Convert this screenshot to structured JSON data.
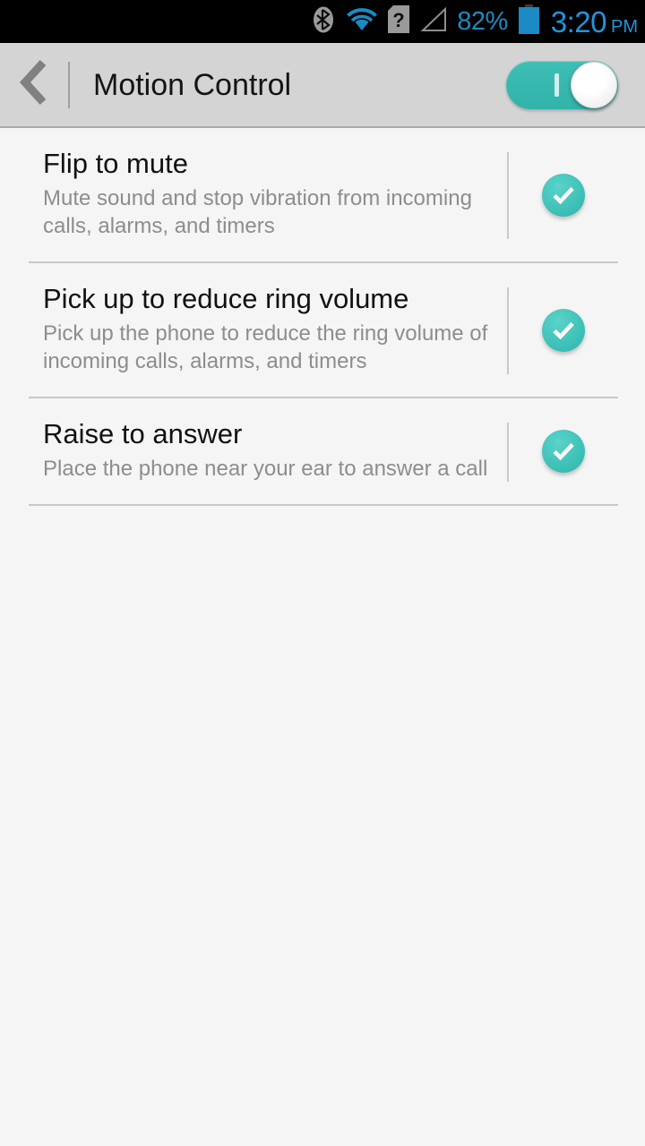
{
  "status_bar": {
    "background": "#000000",
    "accent": "#2196dd",
    "icons": [
      {
        "name": "bluetooth-icon",
        "state": "on",
        "color": "#9a9a9a"
      },
      {
        "name": "wifi-icon",
        "state": "connected",
        "color": "#1a8bc4"
      },
      {
        "name": "sim-card-unknown-icon",
        "state": "unknown",
        "color": "#9a9a9a"
      },
      {
        "name": "cellular-signal-icon",
        "state": "no-service",
        "color": "#8f8f8f"
      }
    ],
    "battery_percent_label": "82%",
    "battery_percent_value": 82,
    "battery_icon_name": "battery-icon",
    "clock_time": "3:20",
    "clock_meridiem": "PM"
  },
  "header": {
    "background": "#d4d4d4",
    "back_icon_name": "chevron-left-icon",
    "title": "Motion Control",
    "master_toggle": {
      "label": "Motion Control master switch",
      "state": "on",
      "on_mark": "I",
      "accent": "#36bdb4"
    }
  },
  "theme": {
    "accent_teal": "#3ec1b8",
    "content_background": "#f5f5f5",
    "divider": "#c8c8c8",
    "title_text": "#111111",
    "summary_text": "#8d8d8d"
  },
  "settings_items": [
    {
      "title": "Flip to mute",
      "summary": "Mute sound and stop vibration from incoming calls, alarms, and timers",
      "checkbox_name": "checkbox-flip-to-mute",
      "checked": true
    },
    {
      "title": "Pick up to reduce ring volume",
      "summary": "Pick up the phone to reduce the ring volume of incoming calls, alarms, and timers",
      "checkbox_name": "checkbox-pick-up-to-reduce-ring-volume",
      "checked": true
    },
    {
      "title": "Raise to answer",
      "summary": "Place the phone near your ear to answer a call",
      "checkbox_name": "checkbox-raise-to-answer",
      "checked": true
    }
  ]
}
